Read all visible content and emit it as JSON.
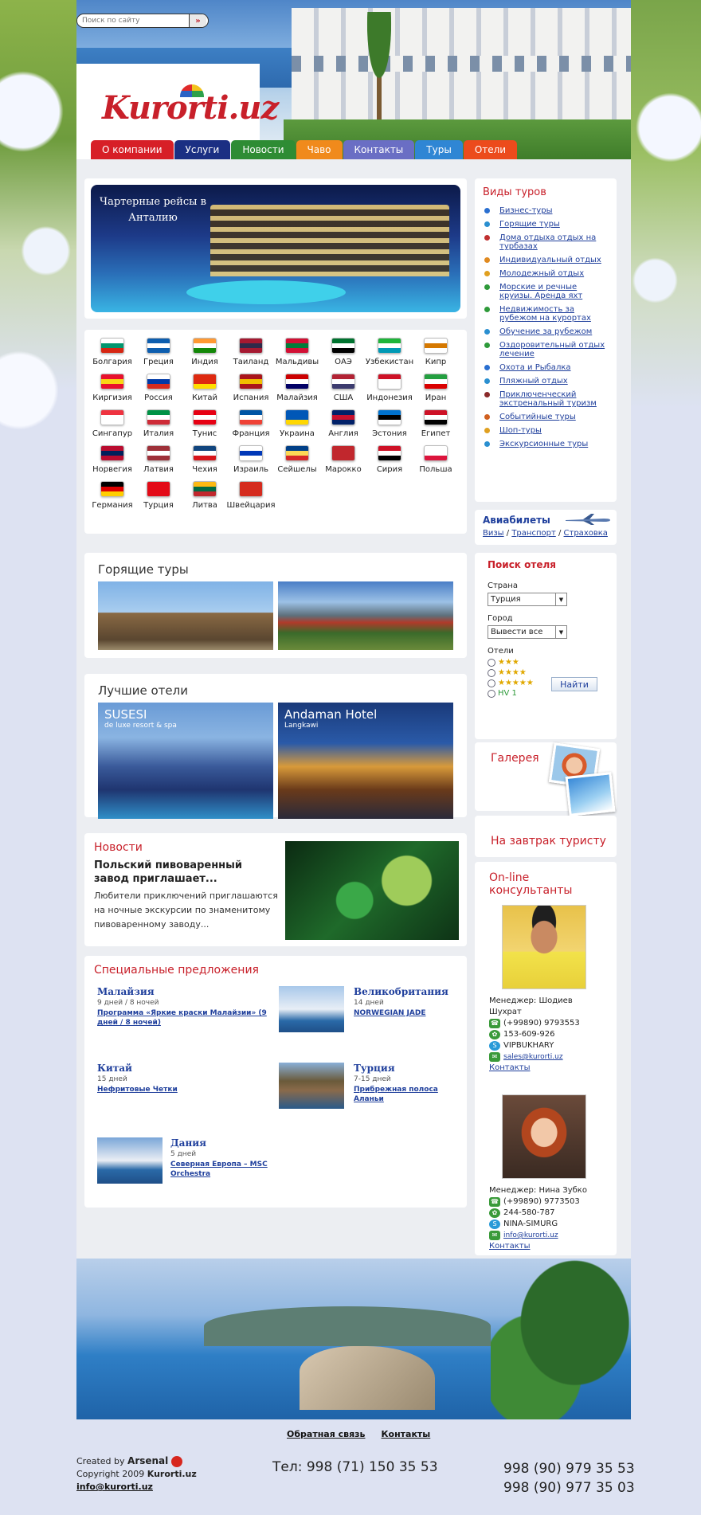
{
  "search": {
    "placeholder": "Поиск по сайту"
  },
  "logo": "Kurorti.uz",
  "nav": [
    {
      "label": "О компании",
      "color": "#d71f27"
    },
    {
      "label": "Услуги",
      "color": "#1b2f83"
    },
    {
      "label": "Новости",
      "color": "#2e8c34"
    },
    {
      "label": "Чаво",
      "color": "#f08a1c"
    },
    {
      "label": "Контакты",
      "color": "#6a6ec4"
    },
    {
      "label": "Туры",
      "color": "#2f86d4"
    },
    {
      "label": "Отели",
      "color": "#ec4b1c"
    }
  ],
  "banner": {
    "text": "Чартерные рейсы в Анталию"
  },
  "countries": [
    {
      "name": "Болгария",
      "flag": [
        "#ffffff",
        "#00966e",
        "#d62612"
      ]
    },
    {
      "name": "Греция",
      "flag": [
        "#0d5eaf",
        "#ffffff",
        "#0d5eaf"
      ]
    },
    {
      "name": "Индия",
      "flag": [
        "#ff9933",
        "#ffffff",
        "#138808"
      ]
    },
    {
      "name": "Таиланд",
      "flag": [
        "#a51931",
        "#2d2a4a",
        "#a51931"
      ]
    },
    {
      "name": "Мальдивы",
      "flag": [
        "#d21034",
        "#007e3a",
        "#d21034"
      ]
    },
    {
      "name": "ОАЭ",
      "flag": [
        "#00732f",
        "#ffffff",
        "#000000"
      ]
    },
    {
      "name": "Узбекистан",
      "flag": [
        "#1eb53a",
        "#ffffff",
        "#0099b5"
      ]
    },
    {
      "name": "Кипр",
      "flag": [
        "#ffffff",
        "#d57800",
        "#ffffff"
      ]
    },
    {
      "name": "Киргизия",
      "flag": [
        "#e8112d",
        "#f9d616",
        "#e8112d"
      ]
    },
    {
      "name": "Россия",
      "flag": [
        "#ffffff",
        "#0039a6",
        "#d52b1e"
      ]
    },
    {
      "name": "Китай",
      "flag": [
        "#de2910",
        "#de2910",
        "#ffde00"
      ]
    },
    {
      "name": "Испания",
      "flag": [
        "#aa151b",
        "#f1bf00",
        "#aa151b"
      ]
    },
    {
      "name": "Малайзия",
      "flag": [
        "#cc0001",
        "#ffffff",
        "#010066"
      ]
    },
    {
      "name": "США",
      "flag": [
        "#b22234",
        "#ffffff",
        "#3c3b6e"
      ]
    },
    {
      "name": "Индонезия",
      "flag": [
        "#ce1126",
        "#ffffff",
        "#ffffff"
      ]
    },
    {
      "name": "Иран",
      "flag": [
        "#239f40",
        "#ffffff",
        "#da0000"
      ]
    },
    {
      "name": "Сингапур",
      "flag": [
        "#ef3340",
        "#ffffff",
        "#ffffff"
      ]
    },
    {
      "name": "Италия",
      "flag": [
        "#009246",
        "#ffffff",
        "#ce2b37"
      ]
    },
    {
      "name": "Тунис",
      "flag": [
        "#e70013",
        "#ffffff",
        "#e70013"
      ]
    },
    {
      "name": "Франция",
      "flag": [
        "#0055a4",
        "#ffffff",
        "#ef4135"
      ]
    },
    {
      "name": "Украина",
      "flag": [
        "#0057b7",
        "#0057b7",
        "#ffd700"
      ]
    },
    {
      "name": "Англия",
      "flag": [
        "#012169",
        "#c8102e",
        "#012169"
      ]
    },
    {
      "name": "Эстония",
      "flag": [
        "#0072ce",
        "#000000",
        "#ffffff"
      ]
    },
    {
      "name": "Египет",
      "flag": [
        "#ce1126",
        "#ffffff",
        "#000000"
      ]
    },
    {
      "name": "Норвегия",
      "flag": [
        "#ba0c2f",
        "#00205b",
        "#ba0c2f"
      ]
    },
    {
      "name": "Латвия",
      "flag": [
        "#9e3039",
        "#ffffff",
        "#9e3039"
      ]
    },
    {
      "name": "Чехия",
      "flag": [
        "#11457e",
        "#ffffff",
        "#d7141a"
      ]
    },
    {
      "name": "Израиль",
      "flag": [
        "#ffffff",
        "#0038b8",
        "#ffffff"
      ]
    },
    {
      "name": "Сейшелы",
      "flag": [
        "#003f87",
        "#fcd856",
        "#d62828"
      ]
    },
    {
      "name": "Марокко",
      "flag": [
        "#c1272d",
        "#c1272d",
        "#c1272d"
      ]
    },
    {
      "name": "Сирия",
      "flag": [
        "#ce1126",
        "#ffffff",
        "#000000"
      ]
    },
    {
      "name": "Польша",
      "flag": [
        "#ffffff",
        "#ffffff",
        "#dc143c"
      ]
    },
    {
      "name": "Германия",
      "flag": [
        "#000000",
        "#dd0000",
        "#ffce00"
      ]
    },
    {
      "name": "Турция",
      "flag": [
        "#e30a17",
        "#e30a17",
        "#e30a17"
      ]
    },
    {
      "name": "Литва",
      "flag": [
        "#fdb913",
        "#006a44",
        "#c1272d"
      ]
    },
    {
      "name": "Швейцария",
      "flag": [
        "#d52b1e",
        "#d52b1e",
        "#d52b1e"
      ]
    }
  ],
  "hot": {
    "title": "Горящие туры"
  },
  "best": {
    "title": "Лучшие отели",
    "hotels": [
      {
        "name": "SUSESI",
        "sub": "de luxe resort & spa"
      },
      {
        "name": "Andaman Hotel",
        "sub": "Langkawi"
      }
    ]
  },
  "news": {
    "title": "Новости",
    "head": "Польский пивоваренный завод приглашает...",
    "text": "Любители приключений приглашаются на ночные экскурсии по знаменитому пивоваренному заводу..."
  },
  "offers": {
    "title": "Специальные предложения",
    "items": [
      {
        "name": "Малайзия",
        "days": "9 дней / 8 ночей",
        "link": "Программа «Яркие краски Малайзии» (9 дней / 8 ночей)"
      },
      {
        "name": "Великобритания",
        "days": "14 дней",
        "link": "NORWEGIAN JADE"
      },
      {
        "name": "Китай",
        "days": "15 дней",
        "link": "Нефритовые Четки"
      },
      {
        "name": "Турция",
        "days": "7-15 дней",
        "link": "Прибрежная полоса Аланьи"
      },
      {
        "name": "Дания",
        "days": "5 дней",
        "link": "Северная Европа – MSC Orchestra"
      }
    ]
  },
  "tours": {
    "title": "Виды туров",
    "items": [
      {
        "label": "Бизнес-туры",
        "color": "#2a6fd0"
      },
      {
        "label": "Горящие туры",
        "color": "#2a8fd0"
      },
      {
        "label": "Дома отдыха отдых на турбазах",
        "color": "#c03030"
      },
      {
        "label": "Индивидуальный отдых",
        "color": "#e08a20"
      },
      {
        "label": "Молодежный отдых",
        "color": "#e0a020"
      },
      {
        "label": "Морские и речные круизы. Аренда яхт",
        "color": "#2e9a3a"
      },
      {
        "label": "Недвижимость за рубежом на курортах",
        "color": "#2e9a3a"
      },
      {
        "label": "Обучение за рубежом",
        "color": "#2a8fd0"
      },
      {
        "label": "Оздоровительный отдых лечение",
        "color": "#2e9a3a"
      },
      {
        "label": "Охота и Рыбалка",
        "color": "#2a6fd0"
      },
      {
        "label": "Пляжный отдых",
        "color": "#2a8fd0"
      },
      {
        "label": "Приключенческий экстренальный туризм",
        "color": "#8a2a2a"
      },
      {
        "label": "Событийные туры",
        "color": "#d06020"
      },
      {
        "label": "Шоп-туры",
        "color": "#e0a020"
      },
      {
        "label": "Экскурсионные туры",
        "color": "#2a8fd0"
      }
    ]
  },
  "avia": {
    "title": "Авиабилеты",
    "links": [
      "Визы",
      "Транспорт",
      "Страховка"
    ],
    "sep": "/"
  },
  "hotel_search": {
    "title": "Поиск отеля",
    "country_label": "Страна",
    "country_value": "Турция",
    "city_label": "Город",
    "city_value": "Вывести все",
    "hotels_label": "Отели",
    "ratings": [
      "★★★",
      "★★★★",
      "★★★★★",
      "HV 1"
    ],
    "find": "Найти"
  },
  "gallery": {
    "title": "Галерея"
  },
  "breakfast": {
    "title": "На завтрак туристу"
  },
  "consult": {
    "title": "On-line консультанты",
    "people": [
      {
        "name": "Менеджер: Шодиев Шухрат",
        "phone": "(+99890) 9793553",
        "icq": "153-609-926",
        "skype": "VIPBUKHARY",
        "email": "sales@kurorti.uz",
        "contacts": "Контакты"
      },
      {
        "name": "Менеджер: Нина Зубко",
        "phone": "(+99890) 9773503",
        "icq": "244-580-787",
        "skype": "NINA-SIMURG",
        "email": "info@kurorti.uz",
        "contacts": "Контакты"
      }
    ]
  },
  "footer": {
    "links": [
      "Обратная связь",
      "Контакты"
    ],
    "created_by": "Created by",
    "arsenal": "Arsenal",
    "copyright_prefix": "Copyright 2009",
    "copyright_site": "Kurorti.uz",
    "email": "info@kurorti.uz",
    "tel1": "Тел: 998 (71) 150 35 53",
    "tel2": "998 (90) 979 35 53",
    "tel3": "998 (90) 977 35 03"
  }
}
